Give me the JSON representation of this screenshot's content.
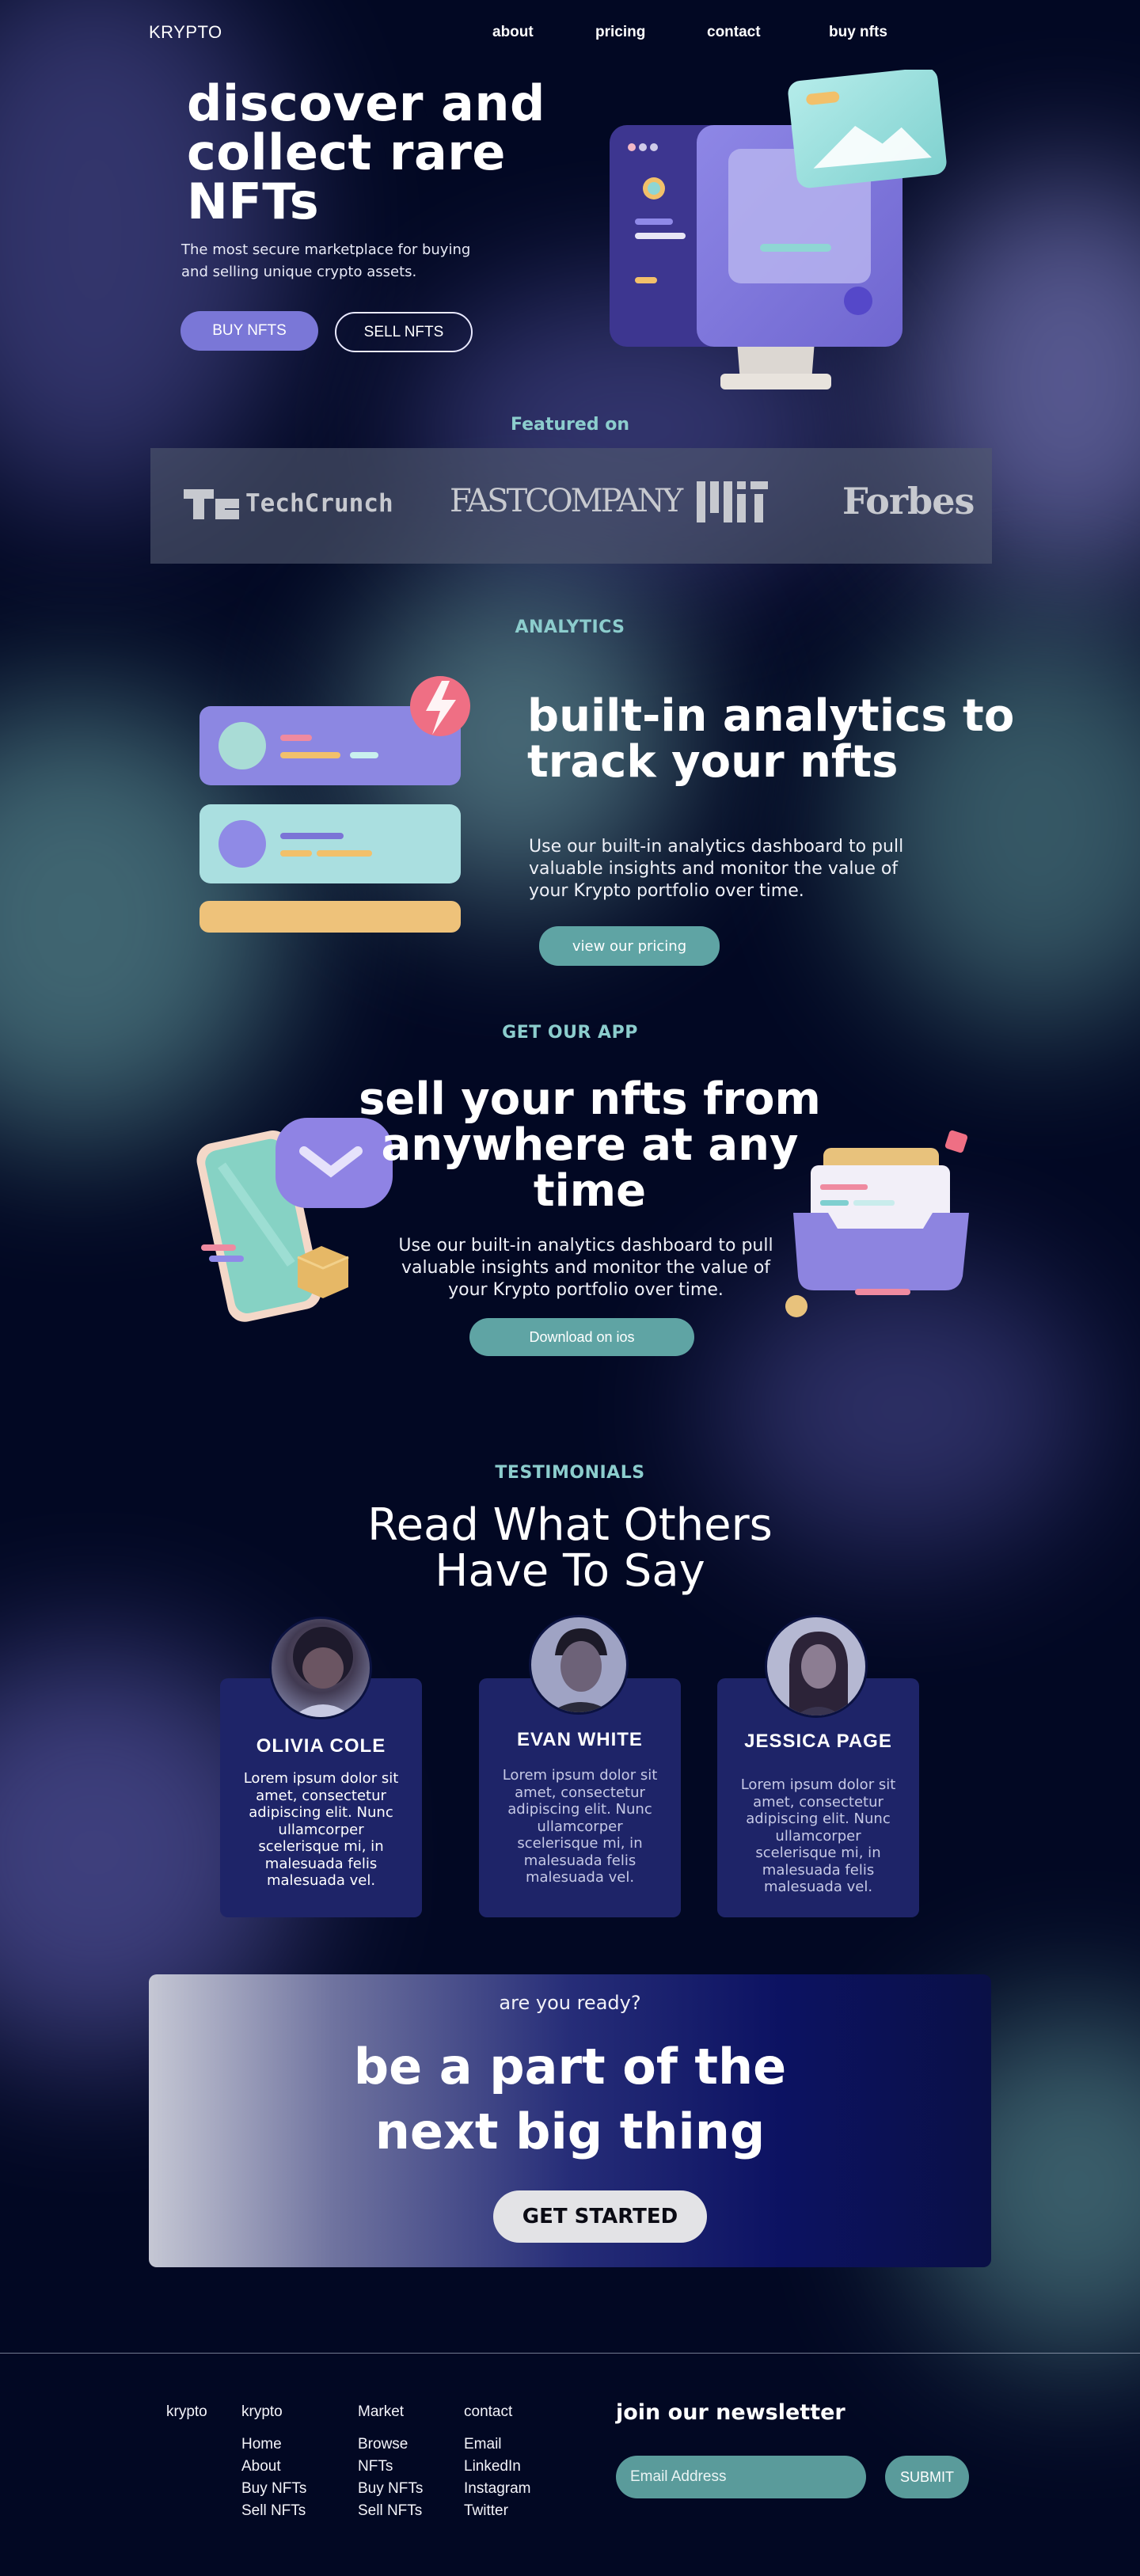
{
  "nav": {
    "logo": "KRYPTO",
    "links": [
      "about",
      "pricing",
      "contact",
      "buy nfts"
    ]
  },
  "hero": {
    "title": "discover and collect rare NFTs",
    "subtitle": "The most secure marketplace for buying and selling unique crypto assets.",
    "buy_label": "BUY NFTS",
    "sell_label": "SELL NFTS"
  },
  "featured": {
    "label": "Featured on",
    "logos": [
      "TechCrunch",
      "FASTCOMPANY",
      "MIT",
      "Forbes"
    ]
  },
  "analytics": {
    "label": "ANALYTICS",
    "title": "built-in analytics to track your nfts",
    "subtitle": "Use our built-in analytics dashboard to pull valuable insights and monitor the value of your Krypto portfolio over time.",
    "button": "view our pricing"
  },
  "app": {
    "label": "GET OUR APP",
    "title": "sell your nfts from anywhere at any time",
    "subtitle": "Use our built-in analytics dashboard to pull valuable insights and monitor the value of your Krypto portfolio over time.",
    "button": "Download on ios"
  },
  "testimonials": {
    "label": "TESTIMONIALS",
    "title_line1": "Read What Others",
    "title_line2": "Have To Say",
    "items": [
      {
        "name": "OLIVIA COLE",
        "text": "Lorem ipsum dolor sit amet, consectetur adipiscing elit. Nunc ullamcorper scelerisque mi, in malesuada felis malesuada vel."
      },
      {
        "name": "EVAN WHITE",
        "text": "Lorem ipsum dolor sit amet, consectetur adipiscing elit. Nunc ullamcorper scelerisque mi, in malesuada felis malesuada vel."
      },
      {
        "name": "JESSICA PAGE",
        "text": "Lorem ipsum dolor sit amet, consectetur adipiscing elit. Nunc ullamcorper scelerisque mi, in malesuada felis malesuada vel."
      }
    ]
  },
  "cta": {
    "small": "are you ready?",
    "title_line1": "be a part of the",
    "title_line2": "next big thing",
    "button": "GET STARTED"
  },
  "footer": {
    "brand": "krypto",
    "columns": [
      {
        "heading": "krypto",
        "items": [
          "Home",
          "About",
          "Buy NFTs",
          "Sell NFTs"
        ]
      },
      {
        "heading": "Market",
        "items": [
          "Browse",
          "NFTs",
          "Buy NFTs",
          "Sell NFTs"
        ]
      },
      {
        "heading": "contact",
        "items": [
          "Email",
          "LinkedIn",
          "Instagram",
          "Twitter"
        ]
      }
    ],
    "newsletter_title": "join our newsletter",
    "email_placeholder": "Email Address",
    "submit": "SUBMIT"
  },
  "colors": {
    "background": "#020823",
    "accent_purple": "#7a77d7",
    "accent_teal": "#5fa4a4",
    "label_teal": "#8ccdcd",
    "card": "#1e2468"
  }
}
